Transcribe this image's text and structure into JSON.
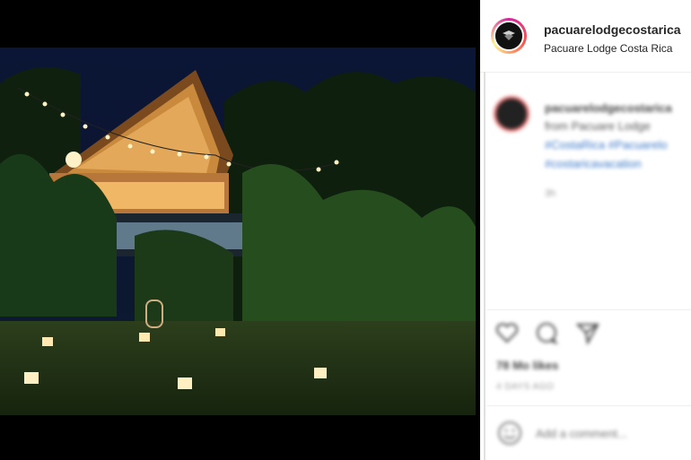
{
  "post": {
    "username": "pacuarelodgecostarica",
    "location": "Pacuare Lodge Costa Rica"
  },
  "caption": {
    "username": "pacuarelodgecostarica",
    "line1": "from Pacuare Lodge",
    "line2": "#CostaRica #Pacuarelo",
    "line3": "#costaricavacation",
    "time": "3h"
  },
  "actions": {
    "icons": [
      "heart-icon",
      "comment-icon",
      "share-icon"
    ],
    "likes_text": "78 Mo likes",
    "posted_text": "4 DAYS AGO"
  },
  "comment": {
    "placeholder": "Add a comment..."
  },
  "colors": {
    "link": "#3b78c9",
    "night_sky": "#0c1430",
    "lamp": "#ffe7a8"
  }
}
